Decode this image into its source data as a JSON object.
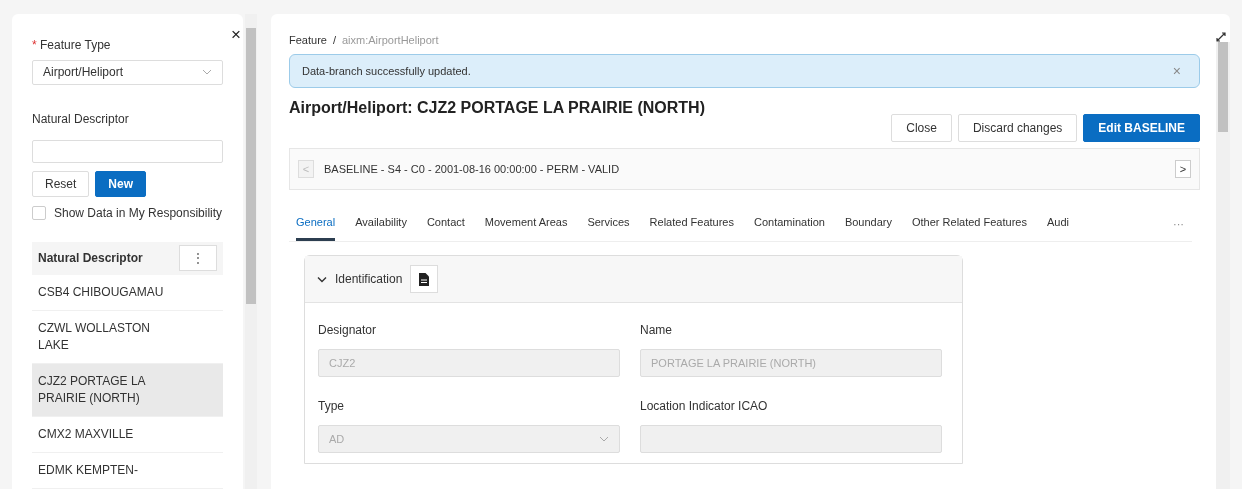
{
  "sidebar": {
    "close_icon": "×",
    "feature_type": {
      "label": "Feature Type",
      "required_mark": "*",
      "value": "Airport/Heliport"
    },
    "descriptor_field": {
      "label": "Natural Descriptor"
    },
    "buttons": [
      {
        "label": "Reset",
        "kind": "secondary"
      },
      {
        "label": "New",
        "kind": "primary"
      }
    ],
    "checkbox": {
      "label": "Show Data in My Responsibility",
      "checked": false
    },
    "table": {
      "column": "Natural Descriptor",
      "menu": "⋮",
      "rows": [
        {
          "text": "CSB4 CHIBOUGAMAU",
          "selected": false
        },
        {
          "text": "CZWL WOLLASTON LAKE",
          "selected": false
        },
        {
          "text": "CJZ2 PORTAGE LA PRAIRIE (NORTH)",
          "selected": true
        },
        {
          "text": "CMX2 MAXVILLE",
          "selected": false
        },
        {
          "text": "EDMK KEMPTEN-",
          "selected": false
        }
      ]
    }
  },
  "main": {
    "breadcrumb": [
      {
        "text": "Feature",
        "kind": "link"
      },
      {
        "text": "/",
        "kind": "separator"
      },
      {
        "text": "aixm:AirportHeliport",
        "kind": "current"
      }
    ],
    "alert": {
      "text": "Data-branch successfully updated.",
      "close": "×"
    },
    "title": "Airport/Heliport: CJZ2 PORTAGE LA PRAIRIE (NORTH)",
    "actions": [
      {
        "label": "Close",
        "kind": "secondary"
      },
      {
        "label": "Discard changes",
        "kind": "secondary"
      },
      {
        "label": "Edit BASELINE",
        "kind": "primary"
      }
    ],
    "version": {
      "prev": "<",
      "text": "BASELINE - S4 - C0 - 2001-08-16 00:00:00 - PERM - VALID",
      "next": ">",
      "prev_disabled": true
    },
    "tabs": [
      {
        "label": "General",
        "selected": true
      },
      {
        "label": "Availability",
        "selected": false
      },
      {
        "label": "Contact",
        "selected": false
      },
      {
        "label": "Movement Areas",
        "selected": false
      },
      {
        "label": "Services",
        "selected": false
      },
      {
        "label": "Related Features",
        "selected": false
      },
      {
        "label": "Contamination",
        "selected": false
      },
      {
        "label": "Boundary",
        "selected": false
      },
      {
        "label": "Other Related Features",
        "selected": false
      },
      {
        "label": "Audi",
        "selected": false
      }
    ],
    "tabs_more": "···",
    "section": {
      "title": "Identification",
      "expanded": true,
      "fields": [
        {
          "label": "Designator",
          "value": "CJZ2",
          "kind": "text",
          "disabled": true
        },
        {
          "label": "Name",
          "value": "PORTAGE LA PRAIRIE (NORTH)",
          "kind": "text",
          "disabled": true
        },
        {
          "label": "Type",
          "value": "AD",
          "kind": "select",
          "disabled": true
        },
        {
          "label": "Location Indicator ICAO",
          "kind": "text",
          "disabled": true
        }
      ]
    }
  }
}
